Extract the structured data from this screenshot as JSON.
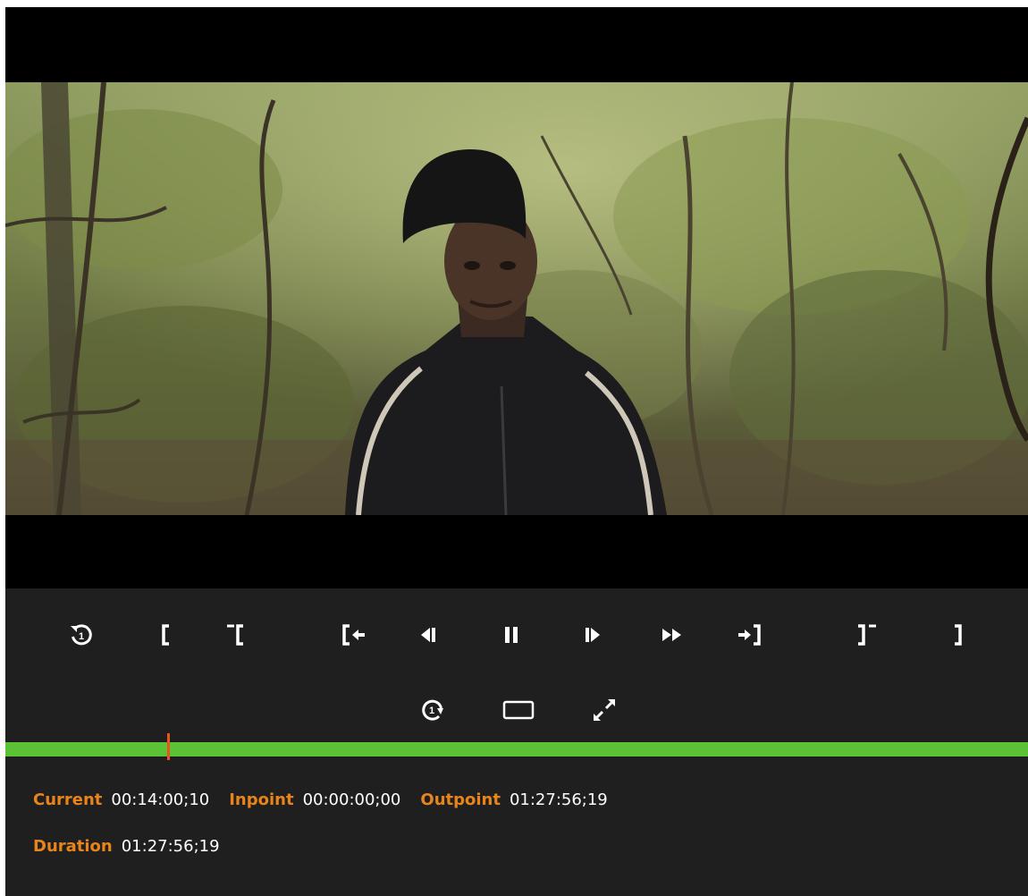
{
  "controls": {
    "row1": [
      {
        "name": "replay-icon",
        "label": "1"
      },
      {
        "name": "set-inpoint-icon"
      },
      {
        "name": "clear-inpoint-icon"
      },
      {
        "name": "go-to-inpoint-icon"
      },
      {
        "name": "step-back-icon"
      },
      {
        "name": "pause-icon"
      },
      {
        "name": "step-forward-icon"
      },
      {
        "name": "fast-forward-icon"
      },
      {
        "name": "go-to-outpoint-icon"
      },
      {
        "name": "clear-outpoint-icon"
      },
      {
        "name": "set-outpoint-icon"
      }
    ],
    "row2": [
      {
        "name": "loop-once-icon",
        "label": "1"
      },
      {
        "name": "aspect-ratio-icon"
      },
      {
        "name": "fullscreen-icon"
      }
    ]
  },
  "timeline": {
    "progress_fraction": 0.159,
    "bar_color": "#5bc236",
    "playhead_color": "#e8541e"
  },
  "info": {
    "current_label": "Current",
    "current_value": "00:14:00;10",
    "inpoint_label": "Inpoint",
    "inpoint_value": "00:00:00;00",
    "outpoint_label": "Outpoint",
    "outpoint_value": "01:27:56;19",
    "duration_label": "Duration",
    "duration_value": "01:27:56;19",
    "label_color": "#e8841c"
  }
}
